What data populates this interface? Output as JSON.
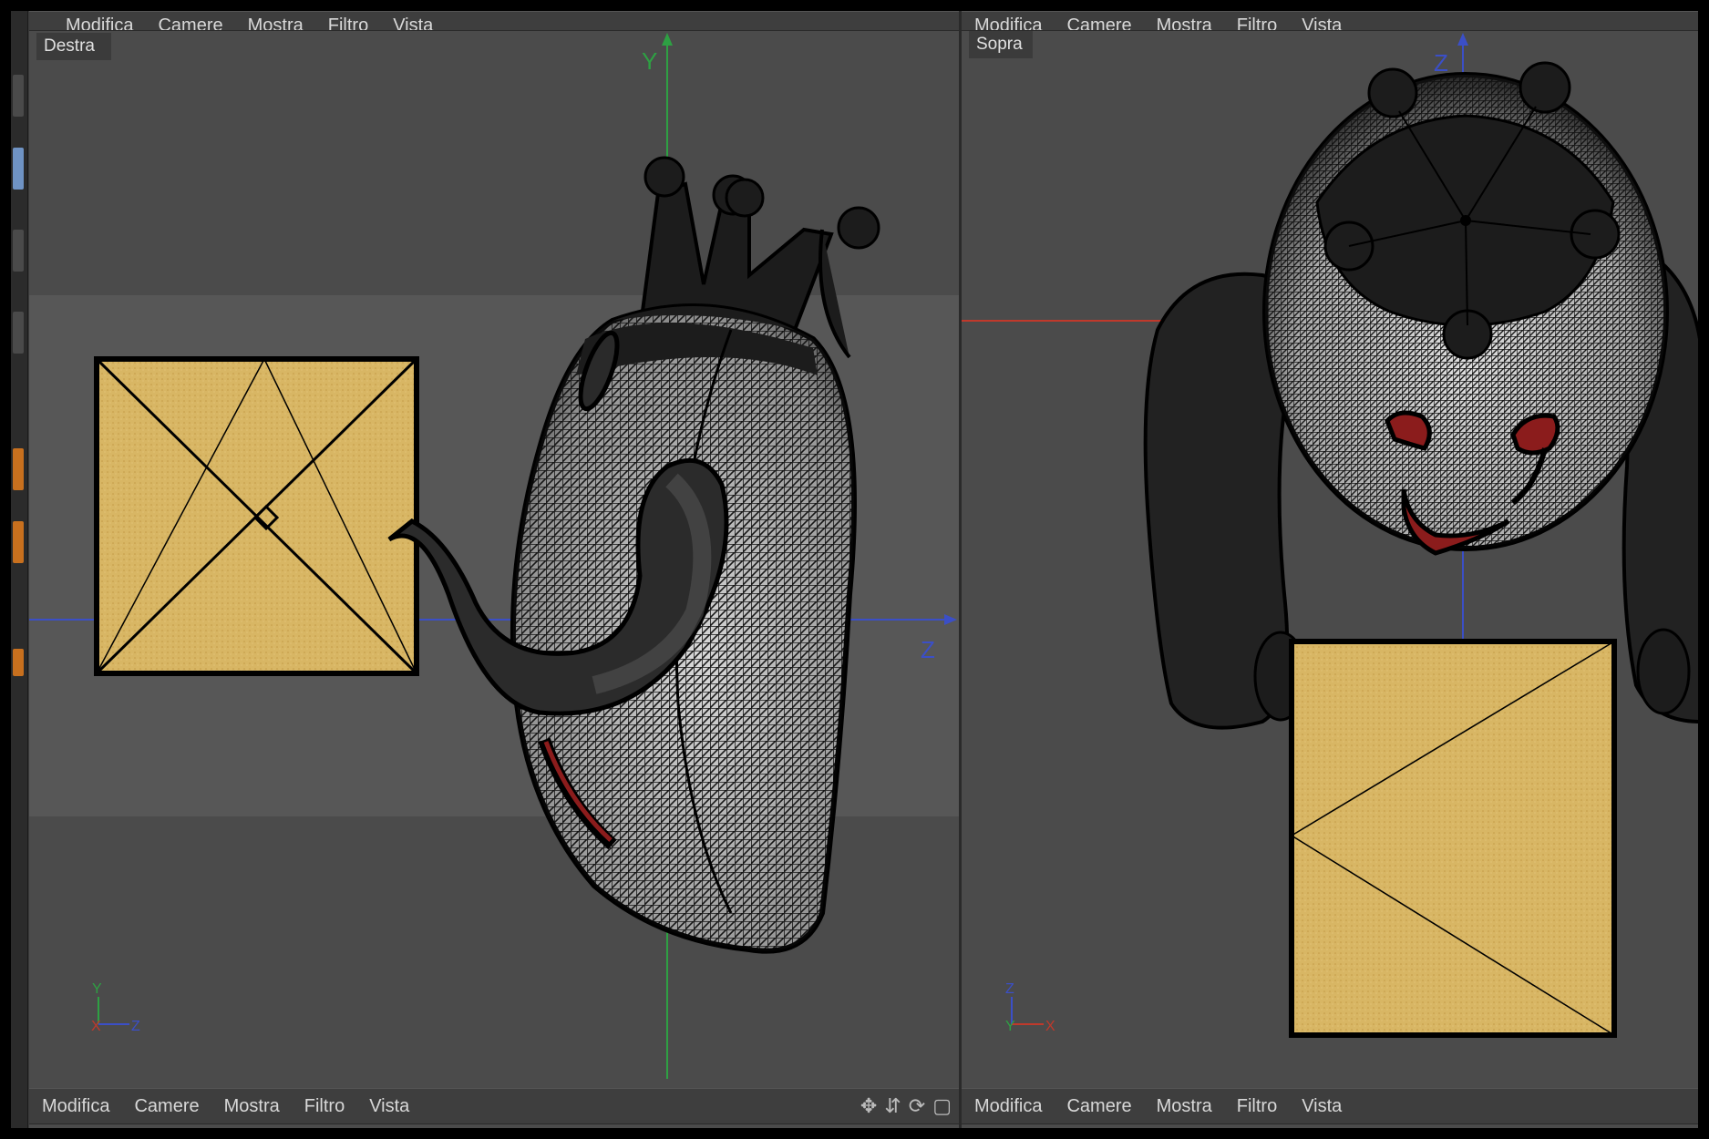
{
  "menu": [
    "Modifica",
    "Camere",
    "Mostra",
    "Filtro",
    "Vista"
  ],
  "viewports": {
    "left": {
      "label": "Destra",
      "axis_main": [
        "Y",
        "Z"
      ],
      "axis_gizmo": [
        "Y",
        "X",
        "Z"
      ]
    },
    "right": {
      "label": "Sopra",
      "axis_main": [
        "Z"
      ],
      "axis_gizmo": [
        "Z",
        "Y",
        "X"
      ]
    }
  },
  "colors": {
    "viewport_bg": "#4b4b4b",
    "cube_face": "#d6b25e",
    "mesh": "#1c1c1c",
    "axis_x": "#c0392b",
    "axis_y": "#2ea043",
    "axis_z": "#3b4fc7"
  },
  "nav_icons": [
    "move-icon",
    "zoom-icon",
    "rotate-icon",
    "maximize-icon"
  ]
}
